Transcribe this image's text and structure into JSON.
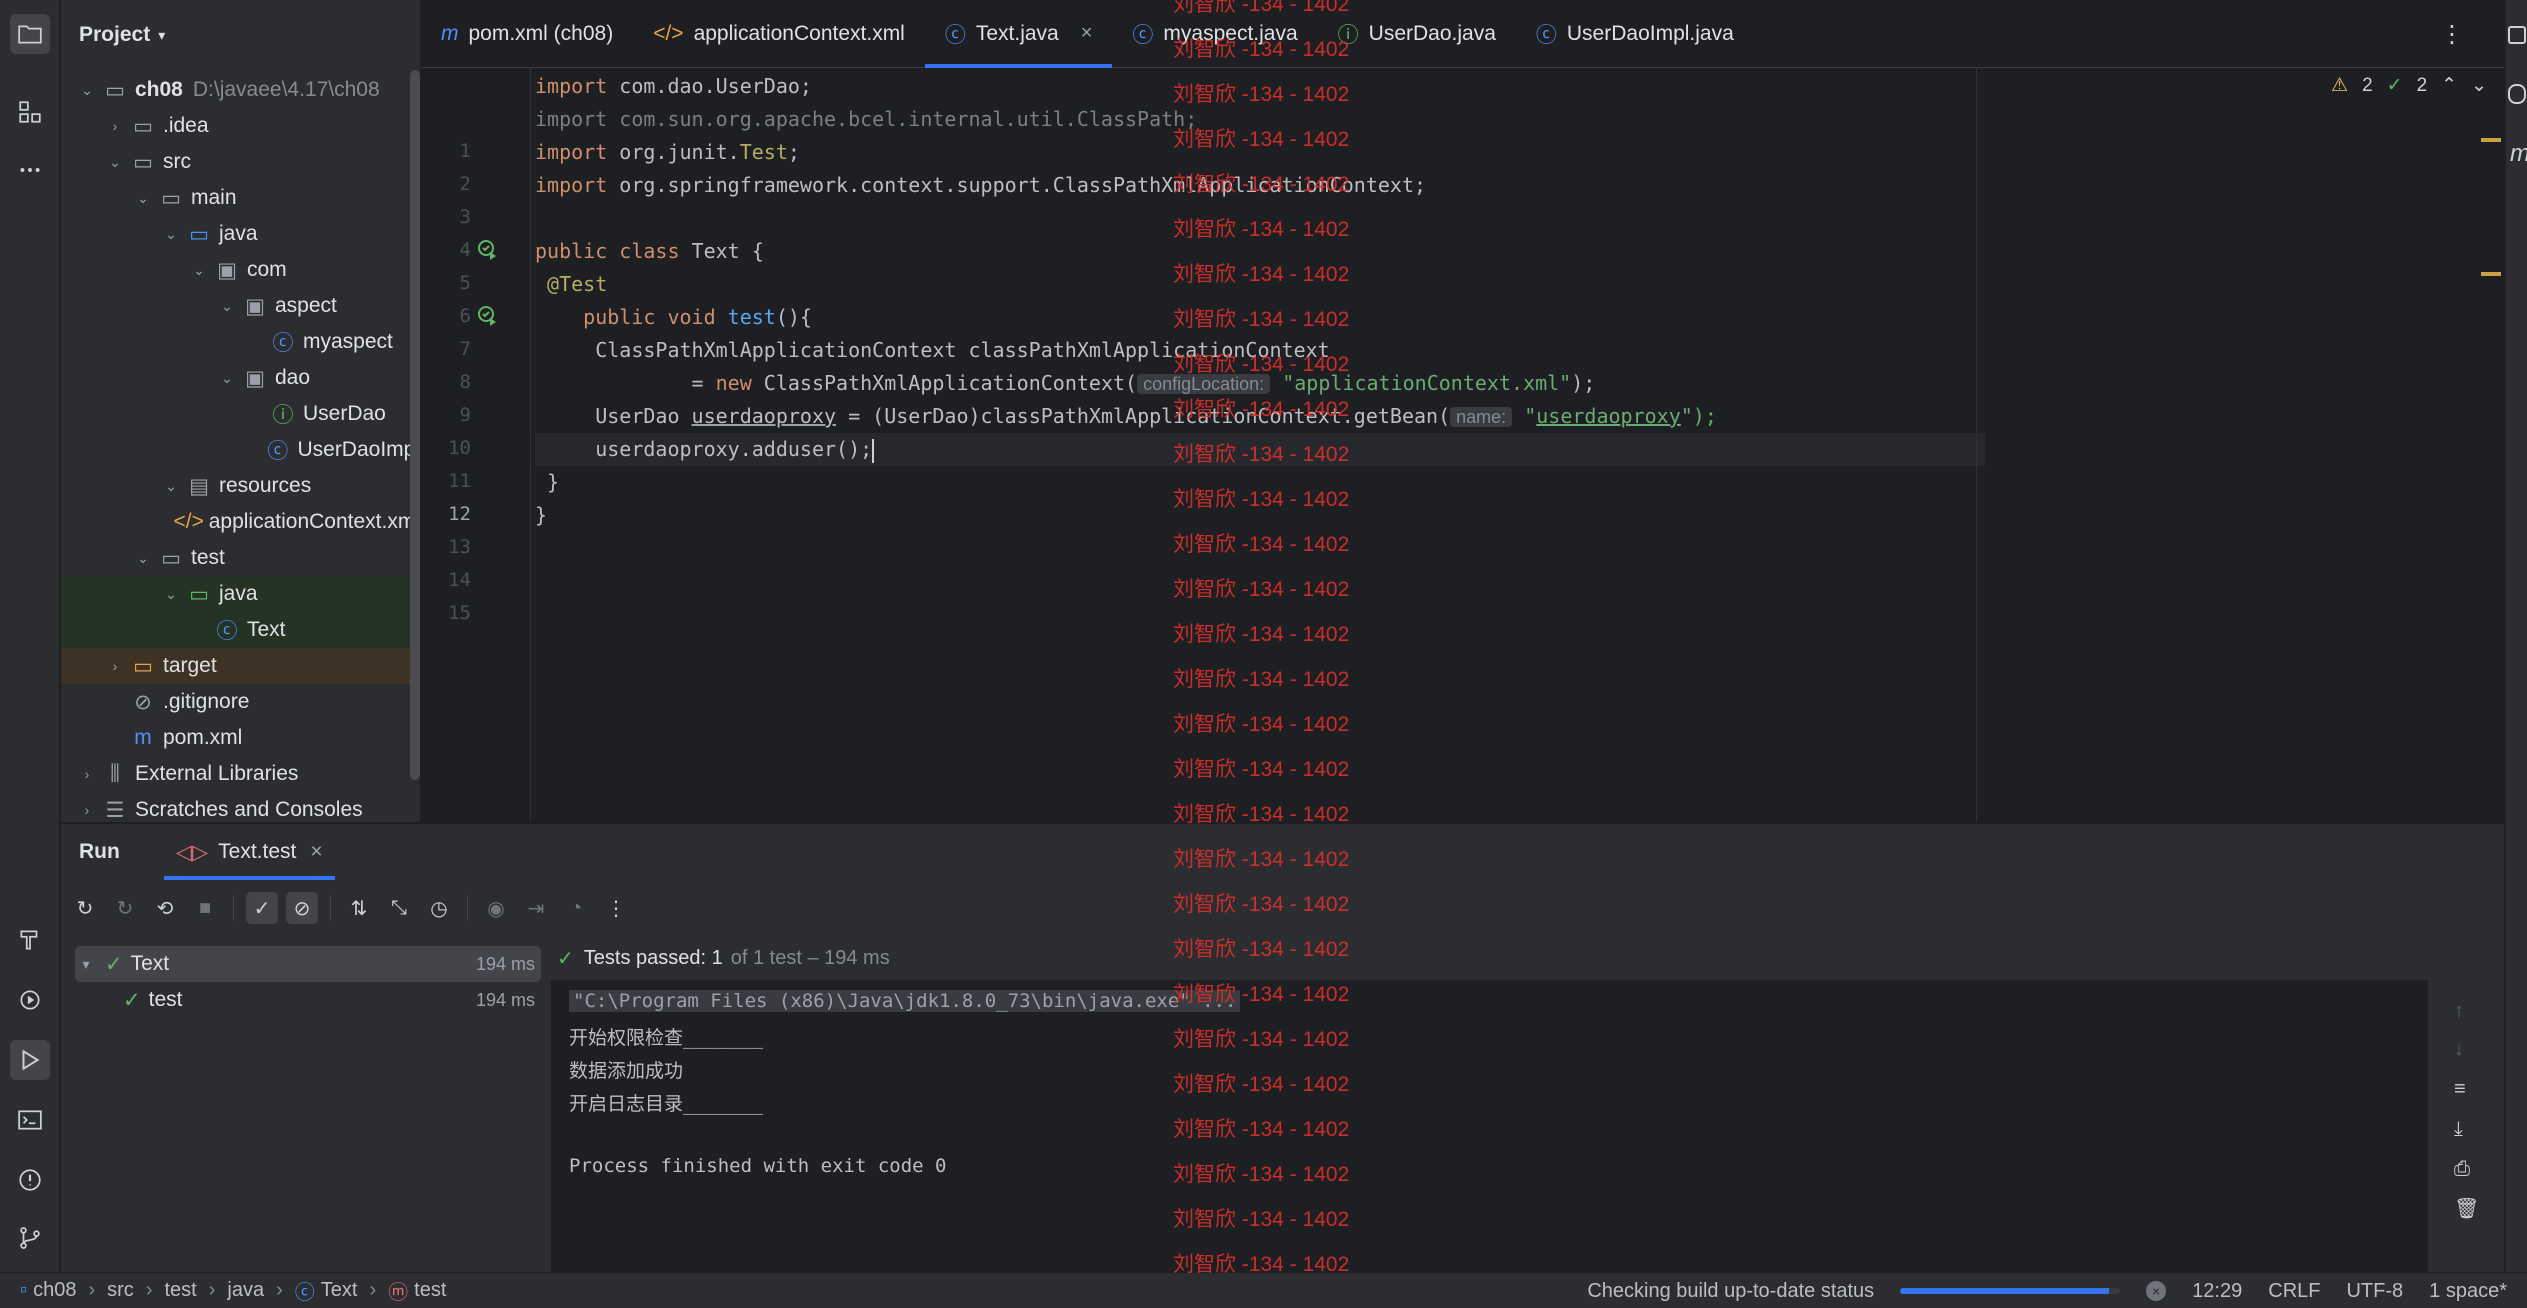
{
  "colors": {
    "accent": "#3574f0",
    "pass": "#5fb865",
    "watermark": "#d9302c"
  },
  "project": {
    "title": "Project",
    "tree": [
      {
        "label": "ch08",
        "hint": "D:\\javaee\\4.17\\ch08",
        "icon": "module-folder-icon"
      },
      {
        "label": ".idea",
        "hint": "",
        "icon": "folder-icon"
      },
      {
        "label": "src",
        "hint": "",
        "icon": "folder-icon"
      },
      {
        "label": "main",
        "hint": "",
        "icon": "folder-icon"
      },
      {
        "label": "java",
        "hint": "",
        "icon": "source-folder-icon"
      },
      {
        "label": "com",
        "hint": "",
        "icon": "package-icon"
      },
      {
        "label": "aspect",
        "hint": "",
        "icon": "package-icon"
      },
      {
        "label": "myaspect",
        "hint": "",
        "icon": "class-icon"
      },
      {
        "label": "dao",
        "hint": "",
        "icon": "package-icon"
      },
      {
        "label": "UserDao",
        "hint": "",
        "icon": "interface-icon"
      },
      {
        "label": "UserDaoImpl",
        "hint": "",
        "icon": "class-icon"
      },
      {
        "label": "resources",
        "hint": "",
        "icon": "resources-folder-icon"
      },
      {
        "label": "applicationContext.xml",
        "hint": "",
        "icon": "xml-file-icon"
      },
      {
        "label": "test",
        "hint": "",
        "icon": "folder-icon"
      },
      {
        "label": "java",
        "hint": "",
        "icon": "test-source-folder-icon"
      },
      {
        "label": "Text",
        "hint": "",
        "icon": "class-icon"
      },
      {
        "label": "target",
        "hint": "",
        "icon": "excluded-folder-icon"
      },
      {
        "label": ".gitignore",
        "hint": "",
        "icon": "ignore-file-icon"
      },
      {
        "label": "pom.xml",
        "hint": "",
        "icon": "maven-icon"
      },
      {
        "label": "External Libraries",
        "hint": "",
        "icon": "libraries-icon"
      },
      {
        "label": "Scratches and Consoles",
        "hint": "",
        "icon": "scratches-icon"
      }
    ]
  },
  "tabs": [
    {
      "label": "pom.xml (ch08)",
      "icon": "maven-icon"
    },
    {
      "label": "applicationContext.xml",
      "icon": "xml-file-icon"
    },
    {
      "label": "Text.java",
      "icon": "class-icon"
    },
    {
      "label": "myaspect.java",
      "icon": "class-icon"
    },
    {
      "label": "UserDao.java",
      "icon": "interface-icon"
    },
    {
      "label": "UserDaoImpl.java",
      "icon": "class-icon"
    }
  ],
  "editor": {
    "line_numbers": [
      "1",
      "2",
      "3",
      "4",
      "5",
      "6",
      "7",
      "8",
      "9",
      "10",
      "11",
      "12",
      "13",
      "14",
      "15"
    ],
    "current_line": 12,
    "inspections": {
      "warnings": "2",
      "ok": "2"
    },
    "lines": {
      "l1": {
        "a": "import ",
        "b": "com.dao.UserDao;"
      },
      "l2": {
        "a": "import com.sun.org.apache.bcel.internal.util.ClassPath;"
      },
      "l3": {
        "a": "import ",
        "b": "org.junit.",
        "c": "Test",
        "d": ";"
      },
      "l4": {
        "a": "import ",
        "b": "org.springframework.context.support.ClassPathXmlApplicationContext;"
      },
      "l6": {
        "a": "public class ",
        "b": "Text",
        "c": " {"
      },
      "l7": {
        "a": " @Test"
      },
      "l8": {
        "a": "    public void ",
        "b": "test",
        "c": "(){"
      },
      "l9": {
        "a": "     ClassPathXmlApplicationContext classPathXmlApplicationContext"
      },
      "l10": {
        "a": "             = ",
        "b": "new ",
        "c": "ClassPathXmlApplicationContext(",
        "hint": "configLocation:",
        "d": " \"applicationContext.xml\"",
        "e": ");"
      },
      "l11": {
        "a": "     UserDao ",
        "b": "userdaoproxy",
        "c": " = (UserDao)classPathXmlApplicationContext.getBean(",
        "hint": "name:",
        "d": " \"",
        "e": "userdaoproxy",
        "f": "\");"
      },
      "l12": {
        "a": "     userdaoproxy.adduser();"
      },
      "l13": {
        "a": " }"
      },
      "l14": {
        "a": "}"
      }
    }
  },
  "watermark": {
    "text": "刘智欣 -134 - 1402",
    "count": 29
  },
  "run": {
    "title": "Run",
    "tab_label": "Text.test",
    "tests": [
      {
        "label": "Text",
        "time": "194 ms"
      },
      {
        "label": "test",
        "time": "194 ms"
      }
    ],
    "summary": {
      "bold": "Tests passed: 1",
      "muted": "of 1 test – 194 ms"
    },
    "console": [
      "\"C:\\Program Files (x86)\\Java\\jdk1.8.0_73\\bin\\java.exe\" ...",
      "开始权限检查_______",
      "数据添加成功",
      "开启日志目录_______",
      "",
      "Process finished with exit code 0"
    ]
  },
  "status": {
    "breadcrumbs": [
      "ch08",
      "src",
      "test",
      "java",
      "Text",
      "test"
    ],
    "task": "Checking build up-to-date status",
    "progress": 0.95,
    "position": "12:29",
    "line_sep": "CRLF",
    "encoding": "UTF-8",
    "indent": "1 space*"
  }
}
